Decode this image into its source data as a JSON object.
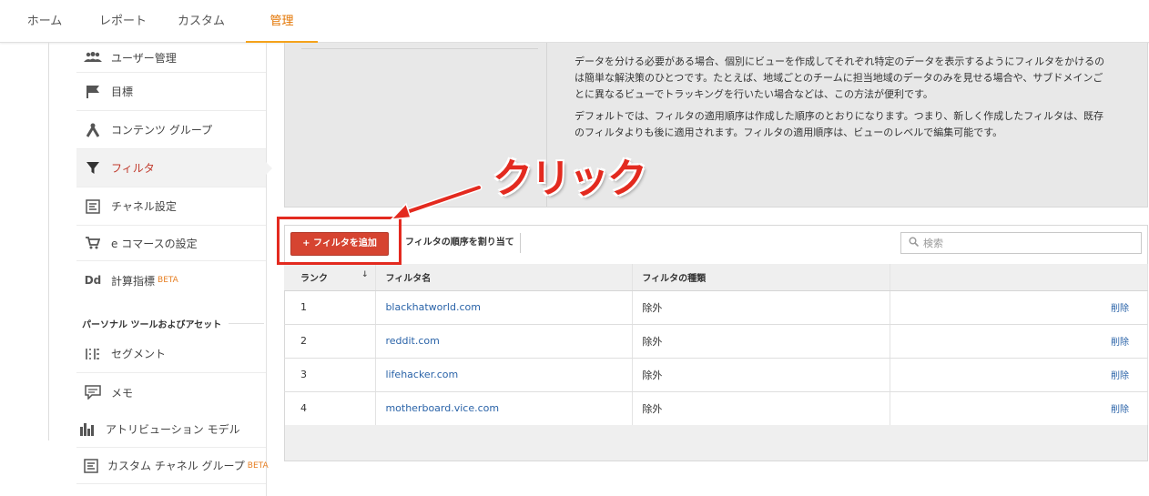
{
  "nav": {
    "tabs": [
      {
        "label": "ホーム"
      },
      {
        "label": "レポート"
      },
      {
        "label": "カスタム"
      },
      {
        "label": "管理"
      }
    ]
  },
  "sidebar": {
    "items": [
      {
        "label": "ユーザー管理",
        "icon": "users-icon"
      },
      {
        "label": "目標",
        "icon": "flag-icon"
      },
      {
        "label": "コンテンツ グループ",
        "icon": "content-group-icon"
      },
      {
        "label": "フィルタ",
        "icon": "filter-icon"
      },
      {
        "label": "チャネル設定",
        "icon": "channel-icon"
      },
      {
        "label": "e コマースの設定",
        "icon": "cart-icon"
      },
      {
        "label": "計算指標",
        "icon": "dd-icon",
        "badge": "BETA"
      },
      {
        "label": "セグメント",
        "icon": "segment-icon"
      },
      {
        "label": "メモ",
        "icon": "memo-icon"
      },
      {
        "label": "アトリビューション モデル",
        "icon": "attribution-icon"
      },
      {
        "label": "カスタム チャネル グループ",
        "icon": "custom-channel-icon",
        "badge": "BETA"
      }
    ],
    "section_title": "パーソナル ツールおよびアセット"
  },
  "info": {
    "p1": "データを分ける必要がある場合、個別にビューを作成してそれぞれ特定のデータを表示するようにフィルタをかけるのは簡単な解決策のひとつです。たとえば、地域ごとのチームに担当地域のデータのみを見せる場合や、サブドメインごとに異なるビューでトラッキングを行いたい場合などは、この方法が便利です。",
    "p2": "デフォルトでは、フィルタの適用順序は作成した順序のとおりになります。つまり、新しく作成したフィルタは、既存のフィルタよりも後に適用されます。フィルタの適用順序は、ビューのレベルで編集可能です。"
  },
  "annotation": {
    "text": "クリック"
  },
  "toolbar": {
    "add_label": "+ フィルタを追加",
    "order_label": "フィルタの順序を割り当て",
    "search_placeholder": "検索"
  },
  "table": {
    "headers": {
      "rank": "ランク",
      "name": "フィルタ名",
      "type": "フィルタの種類"
    },
    "rows": [
      {
        "rank": "1",
        "name": "blackhatworld.com",
        "type": "除外",
        "action": "削除"
      },
      {
        "rank": "2",
        "name": "reddit.com",
        "type": "除外",
        "action": "削除"
      },
      {
        "rank": "3",
        "name": "lifehacker.com",
        "type": "除外",
        "action": "削除"
      },
      {
        "rank": "4",
        "name": "motherboard.vice.com",
        "type": "除外",
        "action": "削除"
      }
    ]
  },
  "colors": {
    "accent": "#e37400",
    "button": "#d64431",
    "annotation": "#e32a1f",
    "link": "#2a63a8"
  }
}
